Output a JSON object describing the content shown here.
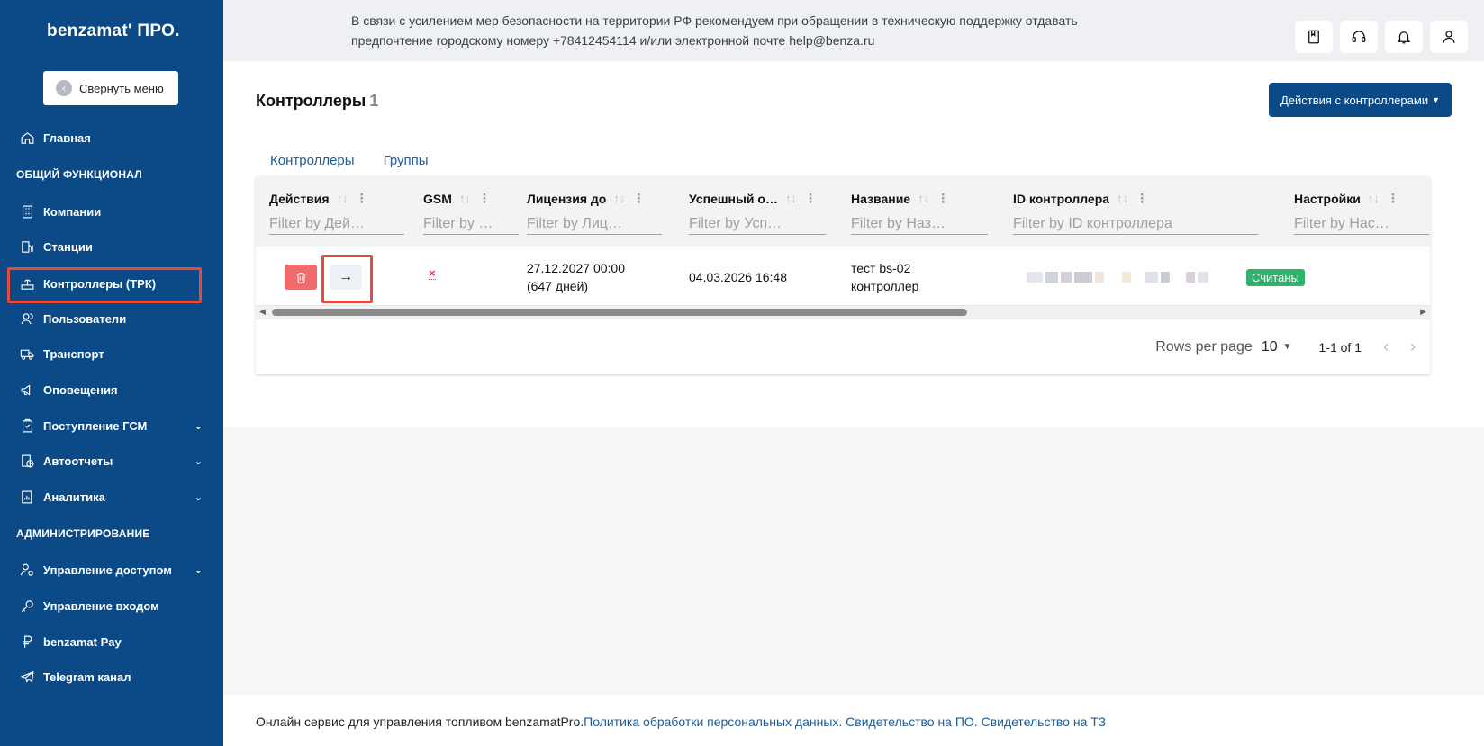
{
  "brand": "benzamat' ПРО.",
  "sidebar": {
    "collapse_label": "Свернуть меню",
    "sections": {
      "general": "ОБЩИЙ ФУНКЦИОНАЛ",
      "admin": "АДМИНИСТРИРОВАНИЕ"
    },
    "items": {
      "home": "Главная",
      "companies": "Компании",
      "stations": "Станции",
      "controllers": "Контроллеры (ТРК)",
      "users": "Пользователи",
      "transport": "Транспорт",
      "notifications": "Оповещения",
      "fuel_income": "Поступление ГСМ",
      "autoreports": "Автоотчеты",
      "analytics": "Аналитика",
      "access": "Управление доступом",
      "login": "Управление входом",
      "pay": "benzamat Pay",
      "telegram": "Telegram канал"
    }
  },
  "topbar": {
    "notice": "В связи с усилением мер безопасности на территории РФ рекомендуем при обращении в техническую поддержку отдавать предпочтение городскому номеру +78412454114 и/или электронной почте help@benza.ru"
  },
  "page": {
    "title": "Контроллеры",
    "count": "1",
    "actions_button": "Действия с контроллерами"
  },
  "tabs": [
    "Контроллеры",
    "Группы"
  ],
  "table": {
    "columns": [
      {
        "label": "Действия",
        "filter": "Filter by Дей…"
      },
      {
        "label": "GSM",
        "filter": "Filter by …"
      },
      {
        "label": "Лицензия до",
        "filter": "Filter by Лиц…"
      },
      {
        "label": "Успешный о…",
        "filter": "Filter by Усп…"
      },
      {
        "label": "Название",
        "filter": "Filter by Наз…"
      },
      {
        "label": "ID контроллера",
        "filter": "Filter by ID контроллера"
      },
      {
        "label": "Настройки",
        "filter": "Filter by Нас…"
      }
    ],
    "rows": [
      {
        "gsm": "×",
        "license_date": "27.12.2027 00:00",
        "license_days": "(647 дней)",
        "success": "04.03.2026 16:48",
        "name_line1": "тест bs-02",
        "name_line2": "контроллер",
        "settings": "Считаны"
      }
    ],
    "rows_per_page_label": "Rows per page",
    "rows_per_page_value": "10",
    "range": "1-1 of 1"
  },
  "footer": {
    "text": "Онлайн сервис для управления топливом benzamatPro.",
    "links": [
      "Политика обработки персональных данных.",
      "Свидетельство на ПО.",
      "Свидетельство на ТЗ"
    ]
  }
}
